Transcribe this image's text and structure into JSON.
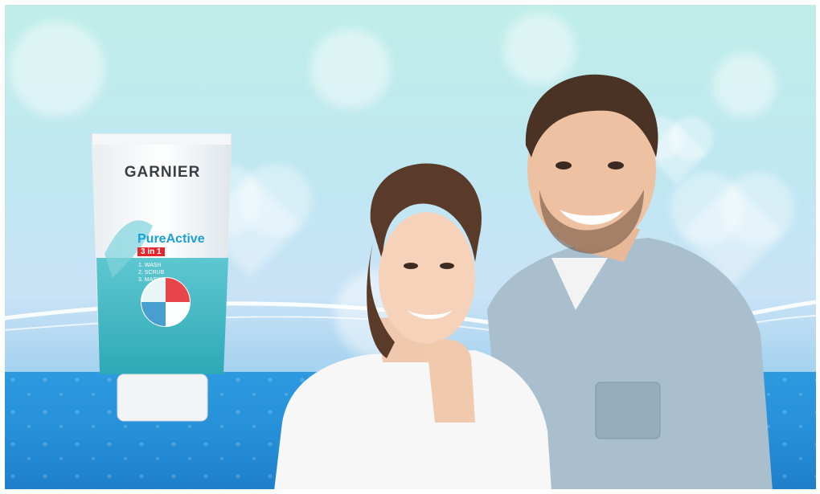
{
  "product": {
    "brand": "GARNIER",
    "line": "PureActive",
    "variant": "3 in 1",
    "benefits": [
      "1. WASH",
      "2. SCRUB",
      "3. MASK"
    ]
  },
  "colors": {
    "sky_top": "#bfeee8",
    "floor": "#2690d9",
    "tube_teal": "#3fb8c4",
    "brand_red": "#e5262d",
    "brand_blue": "#1aa0d8",
    "shirt_denim": "#9fb8c8",
    "tshirt": "#f6f6f6"
  }
}
